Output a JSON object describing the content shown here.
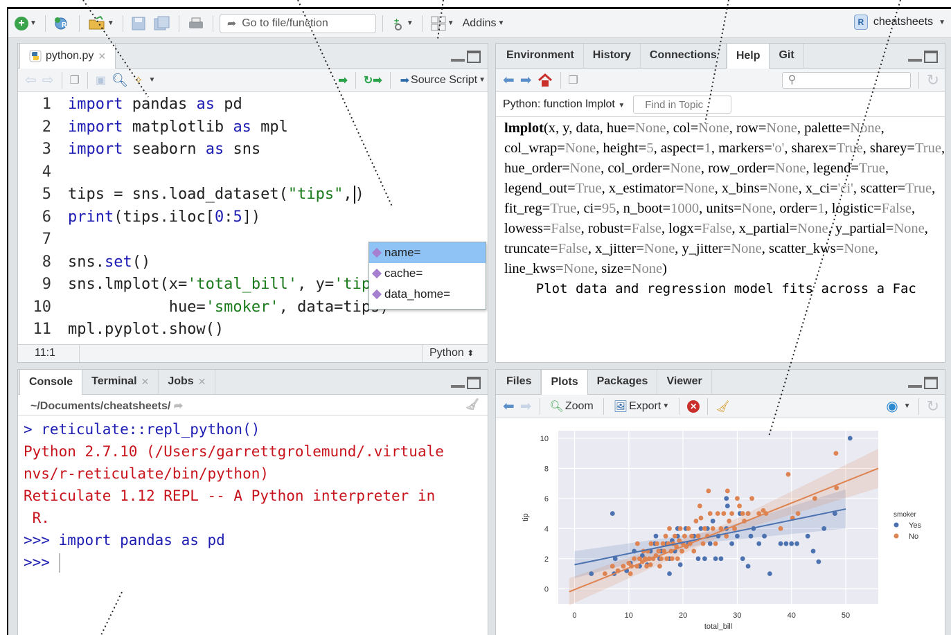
{
  "toolbar": {
    "goto_placeholder": "Go to file/function",
    "addins_label": "Addins",
    "project_label": "cheatsheets",
    "project_badge": "R"
  },
  "source": {
    "file_tab": "python.py",
    "source_button": "Source Script",
    "code_lines": [
      {
        "n": "1",
        "tokens": [
          {
            "t": "import",
            "c": "kw"
          },
          {
            "t": " pandas ",
            "c": ""
          },
          {
            "t": "as",
            "c": "kw"
          },
          {
            "t": " pd",
            "c": ""
          }
        ]
      },
      {
        "n": "2",
        "tokens": [
          {
            "t": "import",
            "c": "kw"
          },
          {
            "t": " matplotlib ",
            "c": ""
          },
          {
            "t": "as",
            "c": "kw"
          },
          {
            "t": " mpl",
            "c": ""
          }
        ]
      },
      {
        "n": "3",
        "tokens": [
          {
            "t": "import",
            "c": "kw"
          },
          {
            "t": " seaborn ",
            "c": ""
          },
          {
            "t": "as",
            "c": "kw"
          },
          {
            "t": " sns",
            "c": ""
          }
        ]
      },
      {
        "n": "4",
        "tokens": []
      },
      {
        "n": "5",
        "tokens": [
          {
            "t": "tips = sns.load_dataset(",
            "c": ""
          },
          {
            "t": "\"tips\"",
            "c": "str"
          },
          {
            "t": ",",
            "c": ""
          }
        ],
        "cursor": true,
        "after": ")"
      },
      {
        "n": "6",
        "tokens": [
          {
            "t": "print",
            "c": "kw"
          },
          {
            "t": "(tips.iloc[",
            "c": ""
          },
          {
            "t": "0",
            "c": "num"
          },
          {
            "t": ":",
            "c": ""
          },
          {
            "t": "5",
            "c": "num"
          },
          {
            "t": "])",
            "c": ""
          }
        ]
      },
      {
        "n": "7",
        "tokens": []
      },
      {
        "n": "8",
        "tokens": [
          {
            "t": "sns.",
            "c": ""
          },
          {
            "t": "set",
            "c": "kw"
          },
          {
            "t": "()",
            "c": ""
          }
        ]
      },
      {
        "n": "9",
        "tokens": [
          {
            "t": "sns.lmplot(x=",
            "c": ""
          },
          {
            "t": "'total_bill'",
            "c": "str"
          },
          {
            "t": ", y=",
            "c": ""
          },
          {
            "t": "'tip'",
            "c": "str"
          },
          {
            "t": ",",
            "c": ""
          }
        ]
      },
      {
        "n": "10",
        "tokens": [
          {
            "t": "           hue=",
            "c": ""
          },
          {
            "t": "'smoker'",
            "c": "str"
          },
          {
            "t": ", data=tips)",
            "c": ""
          }
        ]
      },
      {
        "n": "11",
        "tokens": [
          {
            "t": "mpl.pyplot.show()",
            "c": ""
          }
        ]
      }
    ],
    "autocomplete": [
      "name=",
      "cache=",
      "data_home="
    ],
    "status_position": "11:1",
    "status_language": "Python"
  },
  "env_tabs": [
    "Environment",
    "History",
    "Connections",
    "Help",
    "Git"
  ],
  "help": {
    "topic": "Python: function lmplot",
    "find_placeholder": "Find in Topic",
    "fn_name": "lmplot",
    "params": [
      [
        "x",
        ""
      ],
      [
        "y",
        ""
      ],
      [
        "data",
        ""
      ],
      [
        "hue",
        "None"
      ],
      [
        "col",
        "None"
      ],
      [
        "row",
        "None"
      ],
      [
        "palette",
        "None"
      ],
      [
        "col_wrap",
        "None"
      ],
      [
        "height",
        "5"
      ],
      [
        "aspect",
        "1"
      ],
      [
        "markers",
        "'o'"
      ],
      [
        "sharex",
        "True"
      ],
      [
        "sharey",
        "True"
      ],
      [
        "hue_order",
        "None"
      ],
      [
        "col_order",
        "None"
      ],
      [
        "row_order",
        "None"
      ],
      [
        "legend",
        "True"
      ],
      [
        "legend_out",
        "True"
      ],
      [
        "x_estimator",
        "None"
      ],
      [
        "x_bins",
        "None"
      ],
      [
        "x_ci",
        "'ci'"
      ],
      [
        "scatter",
        "True"
      ],
      [
        "fit_reg",
        "True"
      ],
      [
        "ci",
        "95"
      ],
      [
        "n_boot",
        "1000"
      ],
      [
        "units",
        "None"
      ],
      [
        "order",
        "1"
      ],
      [
        "logistic",
        "False"
      ],
      [
        "lowess",
        "False"
      ],
      [
        "robust",
        "False"
      ],
      [
        "logx",
        "False"
      ],
      [
        "x_partial",
        "None"
      ],
      [
        "y_partial",
        "None"
      ],
      [
        "truncate",
        "False"
      ],
      [
        "x_jitter",
        "None"
      ],
      [
        "y_jitter",
        "None"
      ],
      [
        "scatter_kws",
        "None"
      ],
      [
        "line_kws",
        "None"
      ],
      [
        "size",
        "None"
      ]
    ],
    "description": "    Plot data and regression model fits across a Fac"
  },
  "console": {
    "tabs": [
      {
        "label": "Console"
      },
      {
        "label": "Terminal"
      },
      {
        "label": "Jobs"
      }
    ],
    "path": "~/Documents/cheatsheets/",
    "lines": [
      {
        "text": "> reticulate::repl_python()",
        "c": "con-blue"
      },
      {
        "text": "Python 2.7.10 (/Users/garrettgrolemund/.virtuale",
        "c": "con-red"
      },
      {
        "text": "nvs/r-reticulate/bin/python)",
        "c": "con-red"
      },
      {
        "text": "Reticulate 1.12 REPL -- A Python interpreter in",
        "c": "con-red"
      },
      {
        "text": " R.",
        "c": "con-red"
      },
      {
        "text": ">>> import pandas as pd",
        "c": "con-blue"
      },
      {
        "text": ">>> ",
        "c": "con-blue",
        "cursor": true
      }
    ]
  },
  "files_tabs": [
    "Files",
    "Plots",
    "Packages",
    "Viewer"
  ],
  "plots_toolbar": {
    "zoom": "Zoom",
    "export": "Export"
  },
  "chart_data": {
    "type": "scatter",
    "xlabel": "total_bill",
    "ylabel": "tip",
    "xlim": [
      -3,
      56
    ],
    "ylim": [
      -1,
      10.5
    ],
    "xticks": [
      0,
      10,
      20,
      30,
      40,
      50
    ],
    "yticks": [
      0,
      2,
      4,
      6,
      8,
      10
    ],
    "legend_title": "smoker",
    "legend_position": "right",
    "colors": {
      "Yes": "#4c72b0",
      "No": "#dd8452",
      "bg": "#eaeaf2"
    },
    "series": [
      {
        "name": "Yes",
        "points": [
          [
            3.1,
            1.0
          ],
          [
            7.3,
            1.0
          ],
          [
            7.5,
            2.0
          ],
          [
            9.6,
            1.2
          ],
          [
            10.3,
            1.7
          ],
          [
            11.0,
            2.5
          ],
          [
            12.0,
            1.5
          ],
          [
            12.5,
            2.2
          ],
          [
            13.4,
            1.6
          ],
          [
            14.0,
            2.5
          ],
          [
            14.8,
            3.0
          ],
          [
            15.0,
            3.5
          ],
          [
            15.7,
            2.0
          ],
          [
            16.0,
            2.5
          ],
          [
            17.0,
            3.0
          ],
          [
            17.5,
            2.0
          ],
          [
            18.0,
            3.2
          ],
          [
            18.5,
            2.5
          ],
          [
            19.0,
            3.5
          ],
          [
            19.5,
            1.6
          ],
          [
            20.0,
            3.0
          ],
          [
            20.5,
            4.0
          ],
          [
            21.0,
            3.0
          ],
          [
            22.0,
            3.5
          ],
          [
            22.8,
            2.0
          ],
          [
            23.3,
            4.0
          ],
          [
            24.0,
            2.0
          ],
          [
            24.5,
            4.0
          ],
          [
            25.0,
            3.0
          ],
          [
            25.5,
            4.5
          ],
          [
            26.0,
            2.0
          ],
          [
            26.5,
            3.5
          ],
          [
            27.0,
            2.0
          ],
          [
            28.0,
            4.0
          ],
          [
            28.2,
            5.5
          ],
          [
            29.0,
            3.0
          ],
          [
            30.0,
            3.5
          ],
          [
            30.5,
            5.0
          ],
          [
            31.0,
            2.0
          ],
          [
            32.0,
            1.5
          ],
          [
            32.5,
            3.5
          ],
          [
            33.0,
            4.0
          ],
          [
            34.0,
            3.0
          ],
          [
            35.0,
            3.5
          ],
          [
            36.0,
            1.0
          ],
          [
            38.0,
            3.0
          ],
          [
            39.0,
            3.0
          ],
          [
            40.0,
            3.0
          ],
          [
            41.0,
            3.0
          ],
          [
            43.0,
            3.5
          ],
          [
            44.0,
            2.5
          ],
          [
            45.0,
            1.8
          ],
          [
            46.0,
            4.0
          ],
          [
            48.0,
            5.0
          ],
          [
            50.8,
            10.0
          ],
          [
            28.0,
            6.0
          ],
          [
            32.0,
            5.0
          ],
          [
            7.0,
            5.0
          ],
          [
            17.5,
            1.0
          ],
          [
            19.0,
            4.0
          ]
        ]
      },
      {
        "name": "No",
        "points": [
          [
            5.6,
            1.0
          ],
          [
            7.0,
            1.5
          ],
          [
            8.0,
            1.2
          ],
          [
            9.0,
            1.5
          ],
          [
            10.0,
            1.7
          ],
          [
            10.3,
            1.0
          ],
          [
            10.5,
            1.5
          ],
          [
            11.0,
            2.0
          ],
          [
            11.5,
            1.5
          ],
          [
            11.6,
            3.0
          ],
          [
            12.0,
            2.0
          ],
          [
            12.5,
            1.8
          ],
          [
            12.7,
            2.5
          ],
          [
            13.0,
            2.0
          ],
          [
            13.3,
            1.5
          ],
          [
            13.5,
            2.5
          ],
          [
            13.8,
            2.0
          ],
          [
            14.0,
            1.6
          ],
          [
            14.1,
            3.0
          ],
          [
            14.5,
            2.0
          ],
          [
            15.0,
            2.2
          ],
          [
            15.2,
            3.0
          ],
          [
            15.5,
            2.5
          ],
          [
            15.7,
            1.5
          ],
          [
            16.0,
            2.0
          ],
          [
            16.3,
            3.0
          ],
          [
            16.5,
            2.5
          ],
          [
            16.8,
            3.5
          ],
          [
            17.0,
            2.0
          ],
          [
            17.3,
            3.0
          ],
          [
            17.5,
            4.0
          ],
          [
            17.8,
            2.5
          ],
          [
            18.0,
            2.0
          ],
          [
            18.2,
            3.0
          ],
          [
            18.5,
            3.5
          ],
          [
            18.8,
            2.8
          ],
          [
            19.0,
            2.0
          ],
          [
            19.3,
            3.2
          ],
          [
            19.5,
            4.0
          ],
          [
            19.8,
            2.5
          ],
          [
            20.0,
            3.0
          ],
          [
            20.3,
            3.5
          ],
          [
            20.6,
            2.8
          ],
          [
            21.0,
            4.0
          ],
          [
            21.3,
            3.0
          ],
          [
            21.6,
            3.5
          ],
          [
            22.0,
            2.5
          ],
          [
            22.4,
            4.5
          ],
          [
            22.8,
            3.5
          ],
          [
            23.3,
            4.7
          ],
          [
            23.7,
            3.0
          ],
          [
            24.0,
            4.0
          ],
          [
            24.5,
            3.5
          ],
          [
            25.0,
            5.0
          ],
          [
            25.5,
            4.0
          ],
          [
            26.0,
            3.0
          ],
          [
            26.4,
            5.0
          ],
          [
            27.0,
            4.0
          ],
          [
            27.5,
            5.0
          ],
          [
            28.0,
            3.5
          ],
          [
            28.5,
            4.5
          ],
          [
            29.0,
            5.0
          ],
          [
            29.5,
            4.0
          ],
          [
            30.0,
            6.0
          ],
          [
            30.4,
            5.5
          ],
          [
            31.0,
            5.0
          ],
          [
            31.3,
            4.5
          ],
          [
            32.0,
            5.0
          ],
          [
            32.7,
            6.0
          ],
          [
            34.0,
            5.0
          ],
          [
            34.8,
            5.2
          ],
          [
            35.3,
            5.0
          ],
          [
            38.0,
            4.0
          ],
          [
            39.4,
            7.6
          ],
          [
            40.2,
            4.7
          ],
          [
            41.2,
            5.0
          ],
          [
            48.2,
            9.0
          ],
          [
            48.3,
            6.7
          ],
          [
            44.3,
            6.0
          ],
          [
            28.2,
            6.5
          ],
          [
            24.7,
            6.5
          ],
          [
            23.1,
            5.5
          ]
        ]
      }
    ],
    "fits": [
      {
        "name": "Yes",
        "x": [
          0,
          50
        ],
        "y": [
          1.6,
          5.3
        ]
      },
      {
        "name": "No",
        "x": [
          -1,
          56
        ],
        "y": [
          -0.2,
          8.0
        ]
      }
    ]
  }
}
